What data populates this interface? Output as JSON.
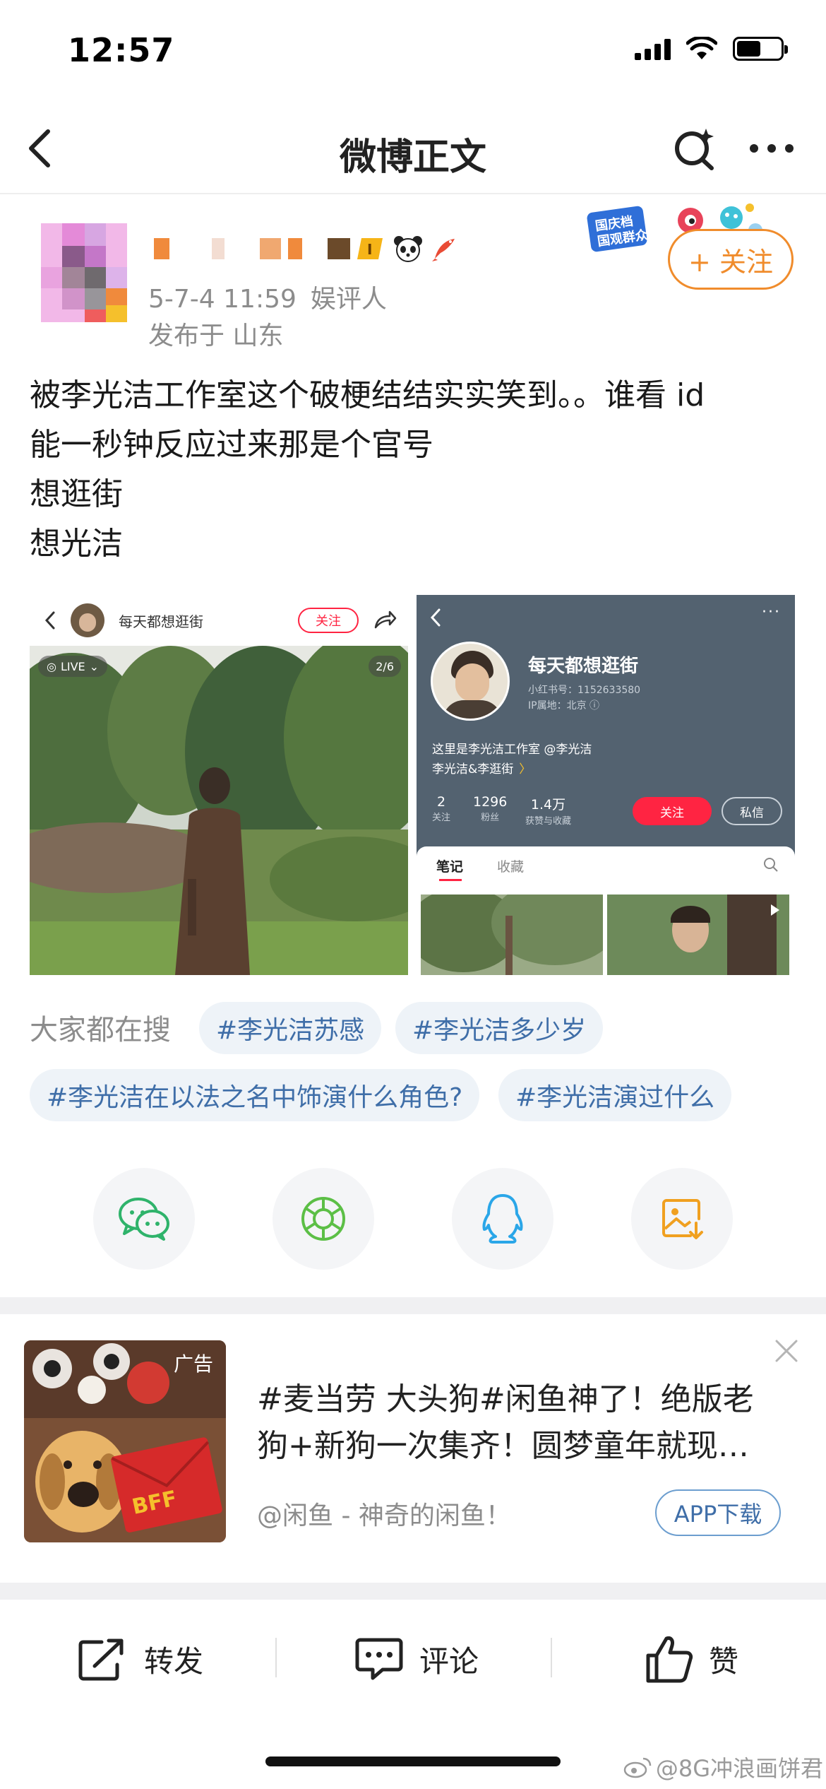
{
  "status_bar": {
    "time": "12:57"
  },
  "nav": {
    "title": "微博正文"
  },
  "post": {
    "meta": "5-7-4 11:59",
    "source": "娱评人",
    "location": "发布于 山东",
    "follow_label": "+ 关注",
    "badge_text": "国庆档 国观群众",
    "text_lines": [
      "被李光洁工作室这个破梗结结实实笑到。。谁看 id",
      "能一秒钟反应过来那是个官号",
      "想逛街",
      "想光洁"
    ]
  },
  "image_left": {
    "account_name": "每天都想逛街",
    "follow_label": "关注",
    "live_label": "LIVE",
    "counter": "2/6"
  },
  "image_right": {
    "profile_name": "每天都想逛街",
    "xhs_id": "小红书号：1152633580",
    "ip_location": "IP属地：北京 ⓘ",
    "bio_line1": "这里是李光洁工作室 @李光洁",
    "bio_line2": "李光洁&李逛街",
    "stats": [
      {
        "value": "2",
        "label": "关注"
      },
      {
        "value": "1296",
        "label": "粉丝"
      },
      {
        "value": "1.4万",
        "label": "获赞与收藏"
      }
    ],
    "follow_label": "关注",
    "message_label": "私信",
    "tabs": [
      "笔记",
      "收藏"
    ]
  },
  "search": {
    "label": "大家都在搜",
    "tags": [
      "#李光洁苏感",
      "#李光洁多少岁",
      "#李光洁在以法之名中饰演什么角色?",
      "#李光洁演过什么"
    ]
  },
  "share_icons": [
    "wechat-icon",
    "moments-icon",
    "qq-icon",
    "save-image-icon"
  ],
  "ad": {
    "label": "广告",
    "title_line1": "#麦当劳 大头狗#闲鱼神了！绝版老",
    "title_line2": "狗+新狗一次集齐！圆梦童年就现…",
    "source": "@闲鱼 - 神奇的闲鱼！",
    "download_label": "APP下载",
    "image_text": "BFF"
  },
  "actions": {
    "repost": "转发",
    "comment": "评论",
    "like": "赞"
  },
  "watermark": "@8G冲浪画饼君",
  "colors": {
    "accent_orange": "#f08c2c",
    "tag_blue": "#3f6ea8",
    "red": "#ff2442"
  }
}
